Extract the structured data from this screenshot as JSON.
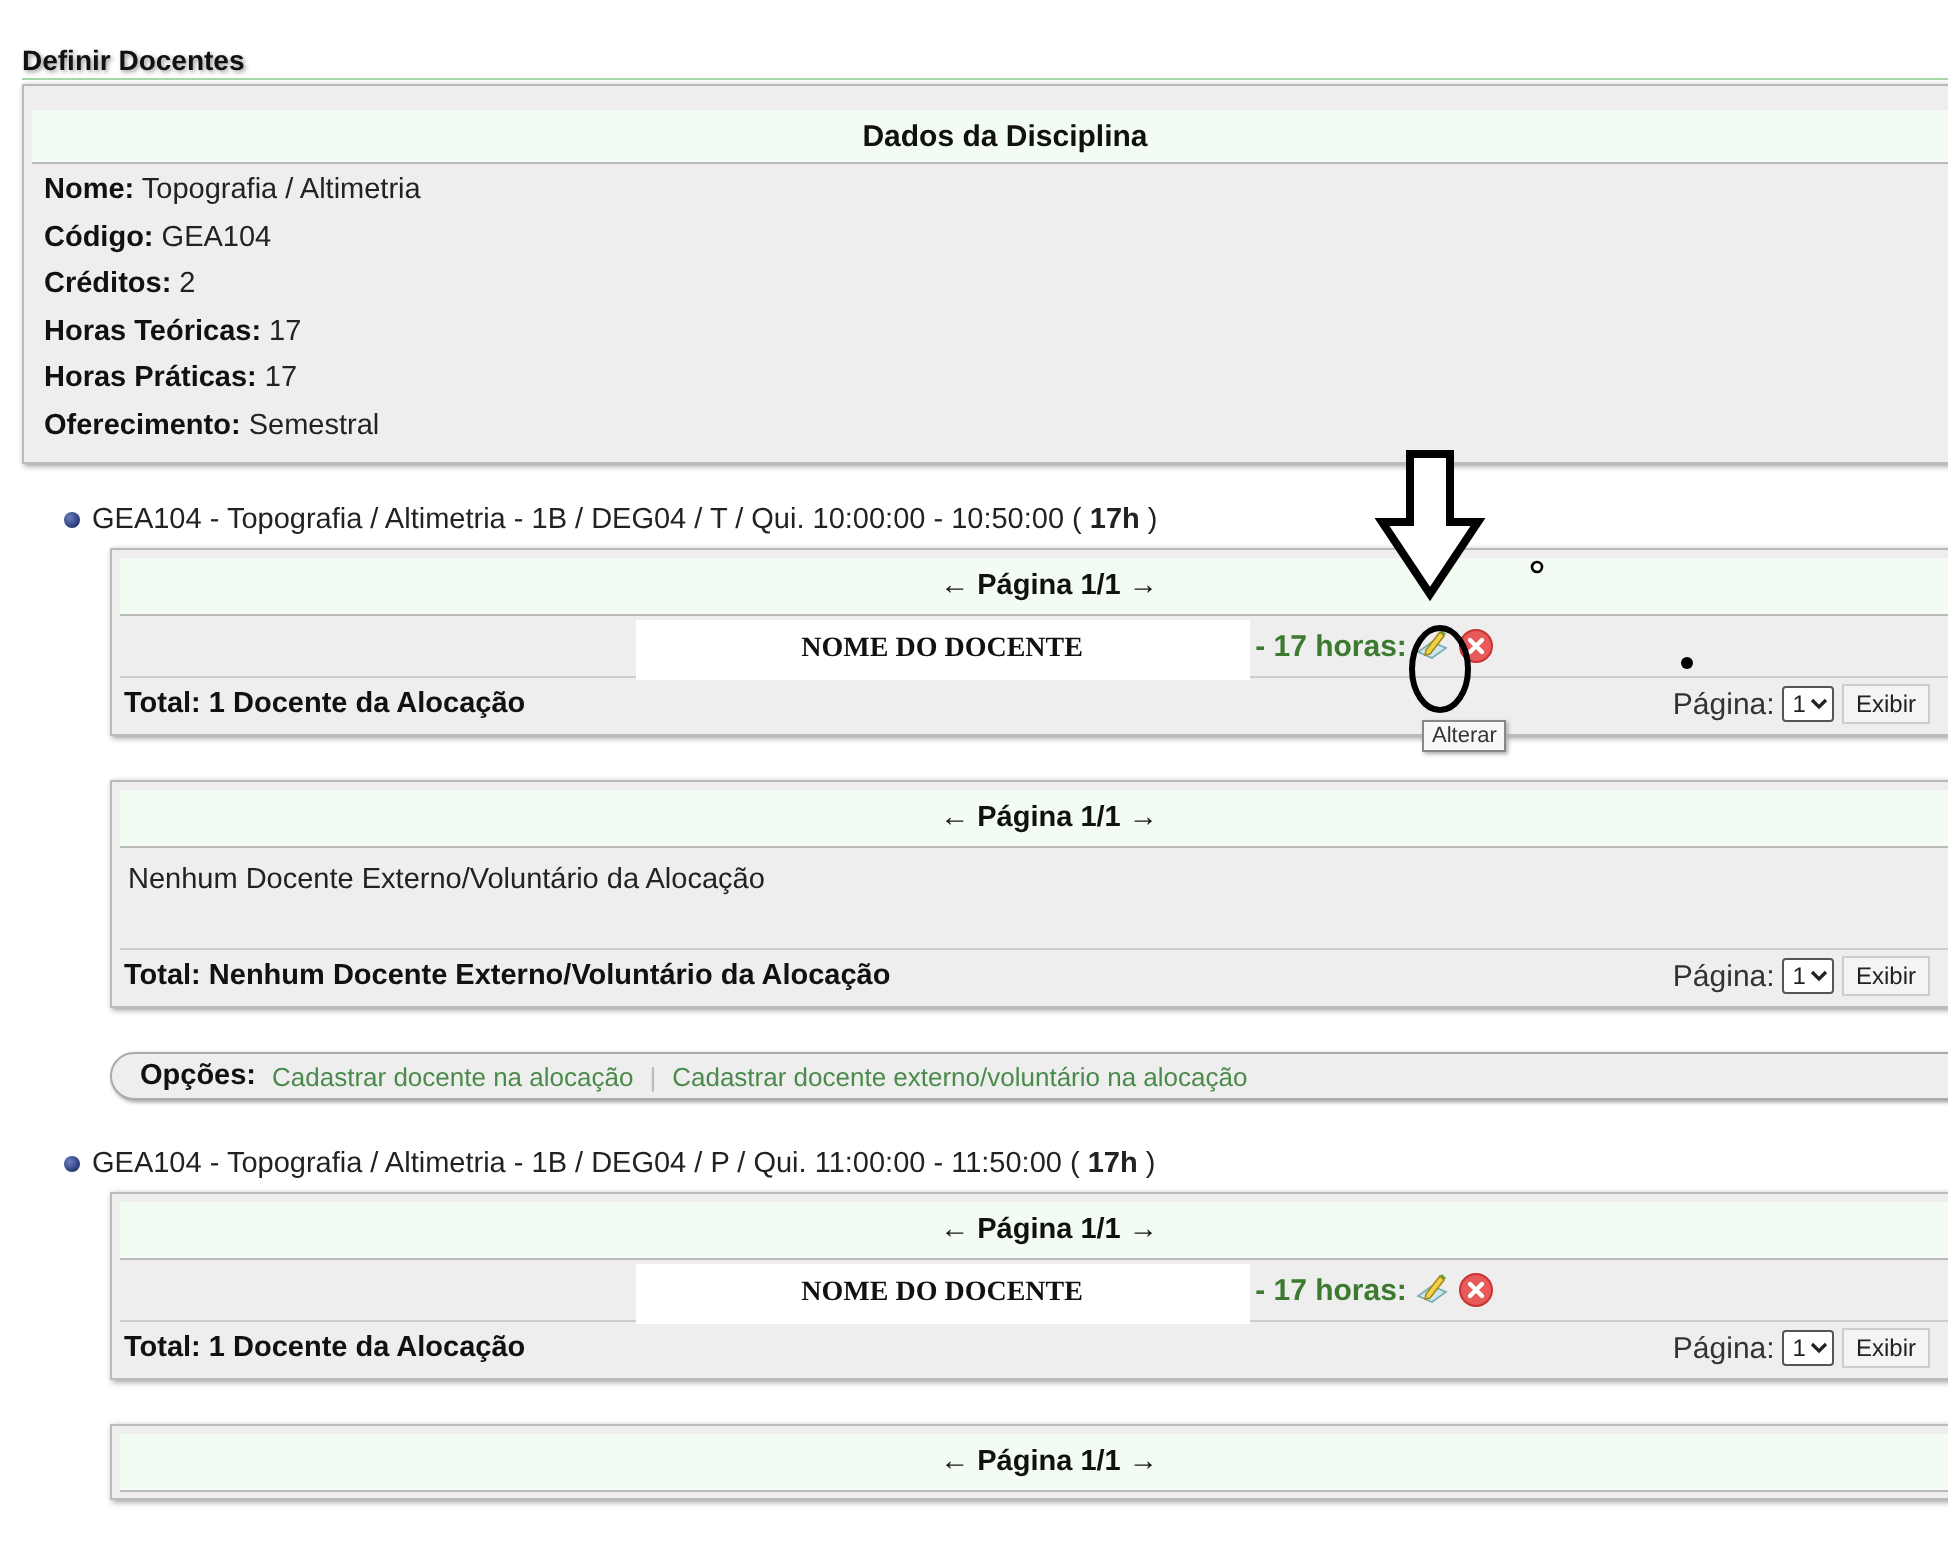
{
  "title": "Definir Docentes",
  "discipline": {
    "header": "Dados da Disciplina",
    "fields": [
      {
        "label": "Nome:",
        "value": "Topografia / Altimetria"
      },
      {
        "label": "Código:",
        "value": "GEA104"
      },
      {
        "label": "Créditos:",
        "value": "2"
      },
      {
        "label": "Horas Teóricas:",
        "value": "17"
      },
      {
        "label": "Horas Práticas:",
        "value": "17"
      },
      {
        "label": "Oferecimento:",
        "value": "Semestral"
      }
    ]
  },
  "allocations": [
    {
      "heading": "GEA104 - Topografia / Altimetria - 1B / DEG04 / T / Qui. 10:00:00 - 10:50:00 ( **17h** )",
      "tables": [
        {
          "pager": "← Página 1/1 →",
          "rows": [
            {
              "name": "NOME DO DOCENTE",
              "hours": "- 17 horas:"
            }
          ],
          "total": "Total: 1 Docente da Alocação",
          "page_label": "Página:",
          "page_value": "1",
          "button": "Exibir"
        },
        {
          "pager": "← Página 1/1 →",
          "message": "Nenhum Docente Externo/Voluntário da Alocação",
          "total": "Total: Nenhum Docente Externo/Voluntário da Alocação",
          "page_label": "Página:",
          "page_value": "1",
          "button": "Exibir"
        }
      ],
      "options": {
        "label": "Opções:",
        "separator": "|",
        "links": [
          "Cadastrar docente na alocação",
          "Cadastrar docente externo/voluntário na alocação"
        ]
      }
    },
    {
      "heading": "GEA104 - Topografia / Altimetria - 1B / DEG04 / P / Qui. 11:00:00 - 11:50:00 ( **17h** )",
      "tables": [
        {
          "pager": "← Página 1/1 →",
          "rows": [
            {
              "name": "NOME DO DOCENTE",
              "hours": "- 17 horas:"
            }
          ],
          "total": "Total: 1 Docente da Alocação",
          "page_label": "Página:",
          "page_value": "1",
          "button": "Exibir"
        },
        {
          "pager": "← Página 1/1 →"
        }
      ]
    }
  ],
  "tooltip": "Alterar"
}
